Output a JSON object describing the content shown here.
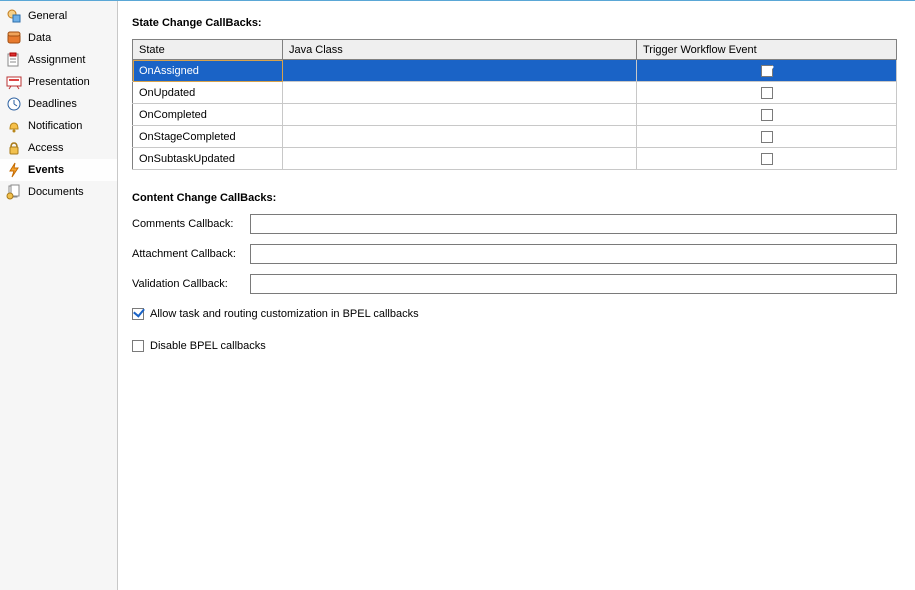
{
  "sidebar": {
    "items": [
      {
        "label": "General",
        "selected": false
      },
      {
        "label": "Data",
        "selected": false
      },
      {
        "label": "Assignment",
        "selected": false
      },
      {
        "label": "Presentation",
        "selected": false
      },
      {
        "label": "Deadlines",
        "selected": false
      },
      {
        "label": "Notification",
        "selected": false
      },
      {
        "label": "Access",
        "selected": false
      },
      {
        "label": "Events",
        "selected": true
      },
      {
        "label": "Documents",
        "selected": false
      }
    ]
  },
  "state_change": {
    "title": "State Change CallBacks:",
    "columns": [
      "State",
      "Java Class",
      "Trigger Workflow Event"
    ],
    "rows": [
      {
        "state": "OnAssigned",
        "java_class": "",
        "trigger": true,
        "selected": true
      },
      {
        "state": "OnUpdated",
        "java_class": "",
        "trigger": false,
        "selected": false
      },
      {
        "state": "OnCompleted",
        "java_class": "",
        "trigger": false,
        "selected": false
      },
      {
        "state": "OnStageCompleted",
        "java_class": "",
        "trigger": false,
        "selected": false
      },
      {
        "state": "OnSubtaskUpdated",
        "java_class": "",
        "trigger": false,
        "selected": false
      }
    ]
  },
  "content_change": {
    "title": "Content Change CallBacks:",
    "fields": {
      "comments": {
        "label": "Comments Callback:",
        "value": ""
      },
      "attachment": {
        "label": "Attachment Callback:",
        "value": ""
      },
      "validation": {
        "label": "Validation Callback:",
        "value": ""
      }
    }
  },
  "options": {
    "allow_custom": {
      "label": "Allow task and routing customization in BPEL callbacks",
      "checked": true
    },
    "disable_bpel": {
      "label": "Disable BPEL callbacks",
      "checked": false
    }
  }
}
